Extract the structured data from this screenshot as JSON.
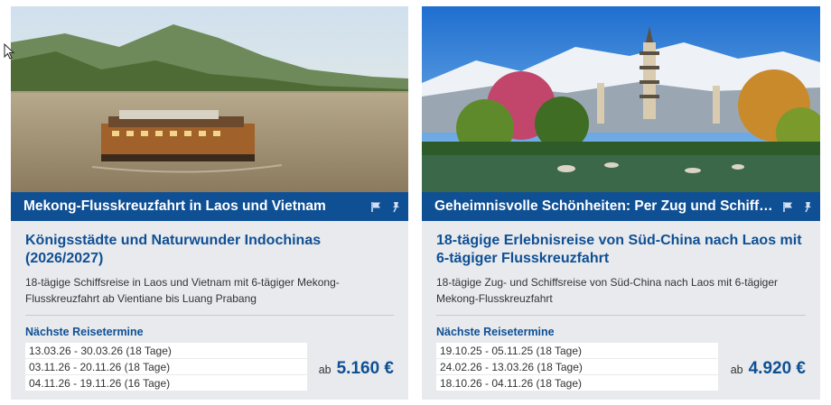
{
  "cards": [
    {
      "banner_title": "Mekong-Flusskreuzfahrt in Laos und Vietnam",
      "headline": "Königsstädte und Naturwunder Indochinas (2026/2027)",
      "description": "18-tägige Schiffsreise in Laos und Vietnam mit 6-tägiger Mekong-Flusskreuzfahrt ab Vientiane bis Luang Prabang",
      "next_dates_title": "Nächste Reisetermine",
      "dates": [
        "13.03.26 - 30.03.26 (18 Tage)",
        "03.11.26 - 20.11.26 (18 Tage)",
        "04.11.26 - 19.11.26 (16 Tage)"
      ],
      "price_prefix": "ab",
      "price": "5.160 €"
    },
    {
      "banner_title": "Geheimnisvolle Schönheiten: Per Zug und Schiff du…",
      "headline": "18-tägige Erlebnisreise von Süd-China nach Laos mit 6-tägiger Flusskreuzfahrt",
      "description": "18-tägige Zug- und Schiffsreise von Süd-China nach Laos mit 6-tägiger Mekong-Flusskreuzfahrt",
      "next_dates_title": "Nächste Reisetermine",
      "dates": [
        "19.10.25 - 05.11.25 (18 Tage)",
        "24.02.26 - 13.03.26 (18 Tage)",
        "18.10.26 - 04.11.26 (18 Tage)"
      ],
      "price_prefix": "ab",
      "price": "4.920 €"
    }
  ],
  "icons": {
    "flag": "flag-icon",
    "pin": "pin-icon"
  },
  "colors": {
    "brand_blue": "#0f4f94",
    "card_bg": "#e8eaed"
  }
}
